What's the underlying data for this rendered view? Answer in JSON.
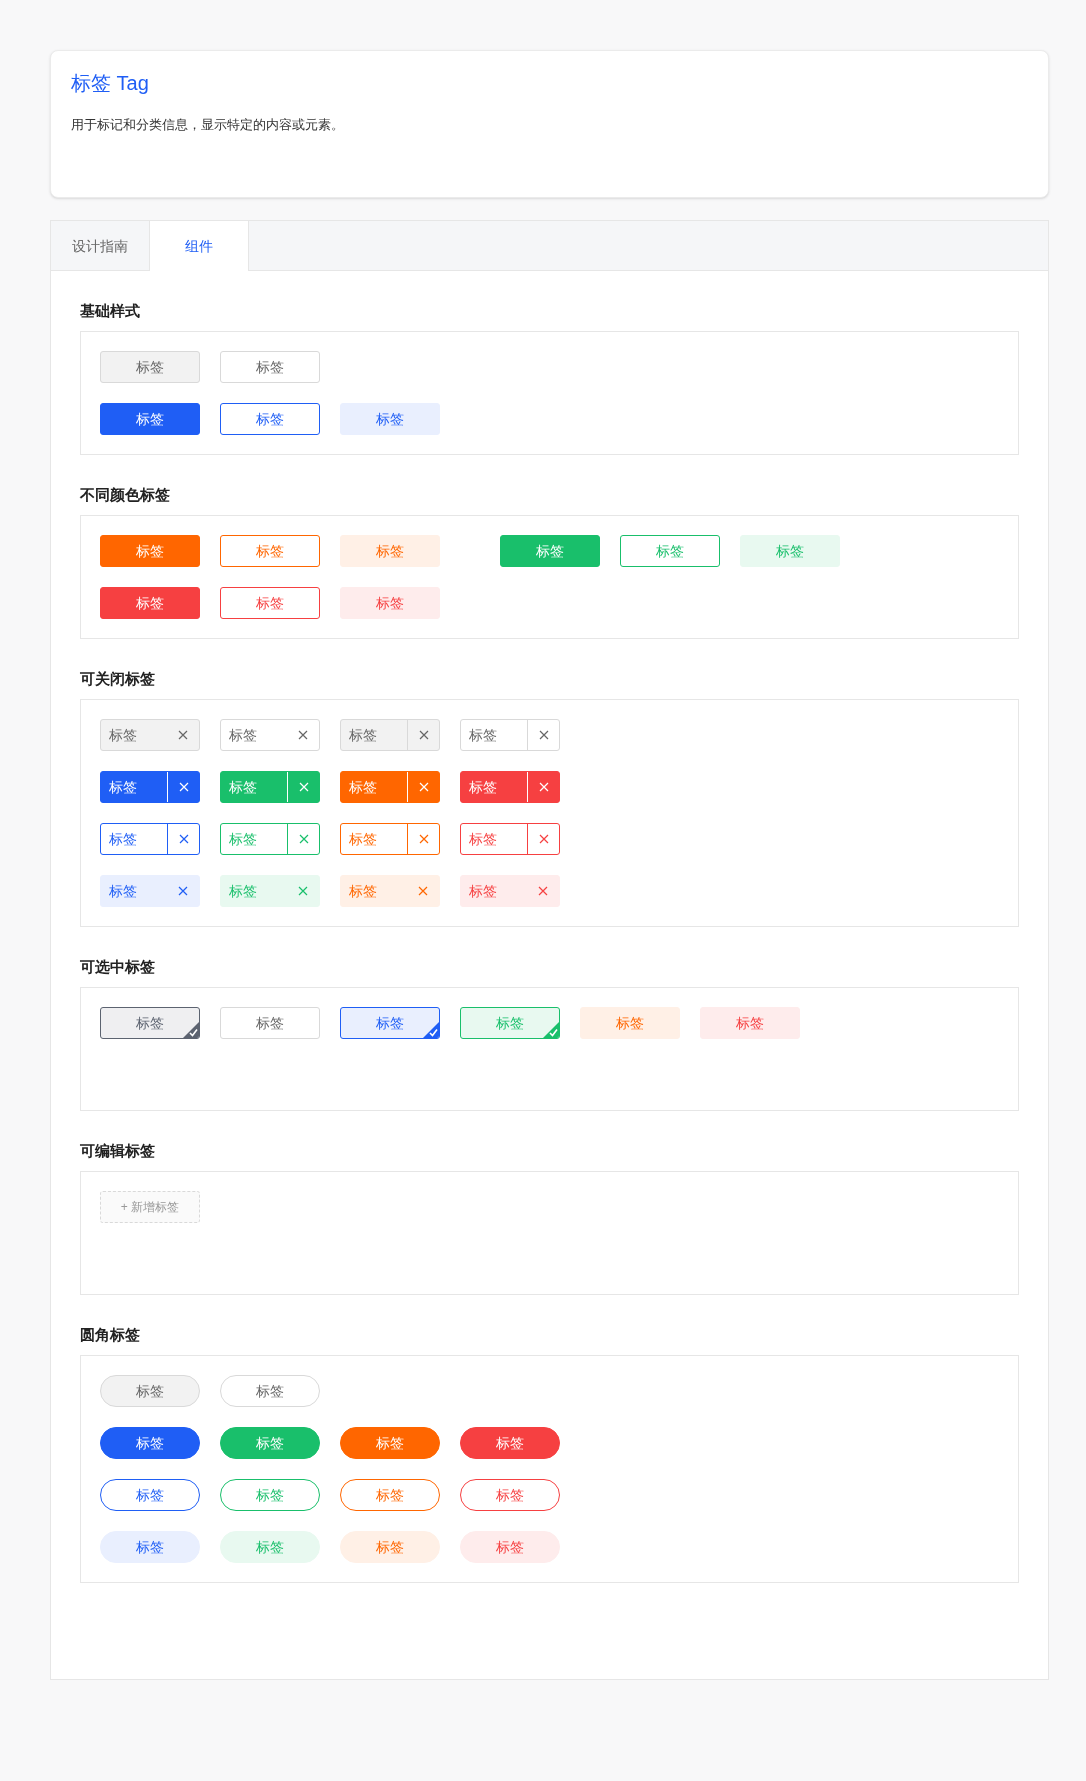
{
  "header": {
    "title": "标签 Tag",
    "description": "用于标记和分类信息，显示特定的内容或元素。"
  },
  "tabs": [
    {
      "label": "设计指南",
      "selected": false
    },
    {
      "label": "组件",
      "selected": true
    }
  ],
  "sections": [
    {
      "kind": "basic",
      "title": "基础样式",
      "rows": [
        [
          {
            "label": "标签",
            "kind": "default"
          },
          {
            "label": "标签",
            "kind": "plain"
          }
        ],
        [
          {
            "label": "标签",
            "kind": "solid",
            "color": "#1f5ef5"
          },
          {
            "label": "标签",
            "kind": "outline",
            "color": "#1f5ef5"
          },
          {
            "label": "标签",
            "kind": "light",
            "color": "#1f5ef5"
          }
        ]
      ]
    },
    {
      "kind": "colors",
      "title": "不同颜色标签",
      "rows": [
        [
          {
            "label": "标签",
            "kind": "solid",
            "color": "#ff6600"
          },
          {
            "label": "标签",
            "kind": "outline",
            "color": "#ff6600"
          },
          {
            "label": "标签",
            "kind": "light",
            "color": "#ff6600"
          }
        ],
        [
          {
            "label": "标签",
            "kind": "solid",
            "color": "#19bf6b"
          },
          {
            "label": "标签",
            "kind": "outline",
            "color": "#19bf6b"
          },
          {
            "label": "标签",
            "kind": "light",
            "color": "#19bf6b"
          }
        ],
        [
          {
            "label": "标签",
            "kind": "solid",
            "color": "#f64041"
          },
          {
            "label": "标签",
            "kind": "outline",
            "color": "#f64041"
          },
          {
            "label": "标签",
            "kind": "light",
            "color": "#f64041"
          }
        ]
      ]
    },
    {
      "kind": "closable",
      "title": "可关闭标签",
      "rows": [
        [
          {
            "label": "标签",
            "kind": "default",
            "split": false
          },
          {
            "label": "标签",
            "kind": "plain",
            "split": false
          },
          {
            "label": "标签",
            "kind": "default",
            "split": true
          },
          {
            "label": "标签",
            "kind": "plain",
            "split": true
          }
        ],
        [
          {
            "label": "标签",
            "kind": "solid",
            "color": "#1f5ef5",
            "split": true
          },
          {
            "label": "标签",
            "kind": "solid",
            "color": "#19bf6b",
            "split": true
          },
          {
            "label": "标签",
            "kind": "solid",
            "color": "#ff6600",
            "split": true
          },
          {
            "label": "标签",
            "kind": "solid",
            "color": "#f64041",
            "split": true
          }
        ],
        [
          {
            "label": "标签",
            "kind": "outline",
            "color": "#1f5ef5",
            "split": true
          },
          {
            "label": "标签",
            "kind": "outline",
            "color": "#19bf6b",
            "split": true
          },
          {
            "label": "标签",
            "kind": "outline",
            "color": "#ff6600",
            "split": true
          },
          {
            "label": "标签",
            "kind": "outline",
            "color": "#f64041",
            "split": true
          }
        ],
        [
          {
            "label": "标签",
            "kind": "light",
            "color": "#1f5ef5",
            "split": false
          },
          {
            "label": "标签",
            "kind": "light",
            "color": "#19bf6b",
            "split": false
          },
          {
            "label": "标签",
            "kind": "light",
            "color": "#ff6600",
            "split": false
          },
          {
            "label": "标签",
            "kind": "light",
            "color": "#f64041",
            "split": false
          }
        ]
      ]
    },
    {
      "kind": "checkable",
      "title": "可选中标签",
      "rows": [
        [
          {
            "label": "标签",
            "kind": "light",
            "color": "#5c6370",
            "checked": true
          },
          {
            "label": "标签",
            "kind": "plain",
            "checked": false
          },
          {
            "label": "标签",
            "kind": "light",
            "color": "#1f5ef5",
            "checked": true
          },
          {
            "label": "标签",
            "kind": "light",
            "color": "#19bf6b",
            "checked": true
          },
          {
            "label": "标签",
            "kind": "light",
            "color": "#ff6600",
            "checked": false
          },
          {
            "label": "标签",
            "kind": "light",
            "color": "#f64041",
            "checked": false
          }
        ]
      ]
    },
    {
      "kind": "editable",
      "title": "可编辑标签",
      "rows": [
        [
          {
            "label": "+ 新增标签",
            "kind": "add"
          }
        ]
      ]
    },
    {
      "kind": "rounded",
      "title": "圆角标签",
      "rows": [
        [
          {
            "label": "标签",
            "kind": "default"
          },
          {
            "label": "标签",
            "kind": "plain"
          }
        ],
        [
          {
            "label": "标签",
            "kind": "solid",
            "color": "#1f5ef5"
          },
          {
            "label": "标签",
            "kind": "solid",
            "color": "#19bf6b"
          },
          {
            "label": "标签",
            "kind": "solid",
            "color": "#ff6600"
          },
          {
            "label": "标签",
            "kind": "solid",
            "color": "#f64041"
          }
        ],
        [
          {
            "label": "标签",
            "kind": "outline",
            "color": "#1f5ef5"
          },
          {
            "label": "标签",
            "kind": "outline",
            "color": "#19bf6b"
          },
          {
            "label": "标签",
            "kind": "outline",
            "color": "#ff6600"
          },
          {
            "label": "标签",
            "kind": "outline",
            "color": "#f64041"
          }
        ],
        [
          {
            "label": "标签",
            "kind": "light",
            "color": "#1f5ef5"
          },
          {
            "label": "标签",
            "kind": "light",
            "color": "#19bf6b"
          },
          {
            "label": "标签",
            "kind": "light",
            "color": "#ff6600"
          },
          {
            "label": "标签",
            "kind": "light",
            "color": "#f64041"
          }
        ]
      ]
    }
  ]
}
